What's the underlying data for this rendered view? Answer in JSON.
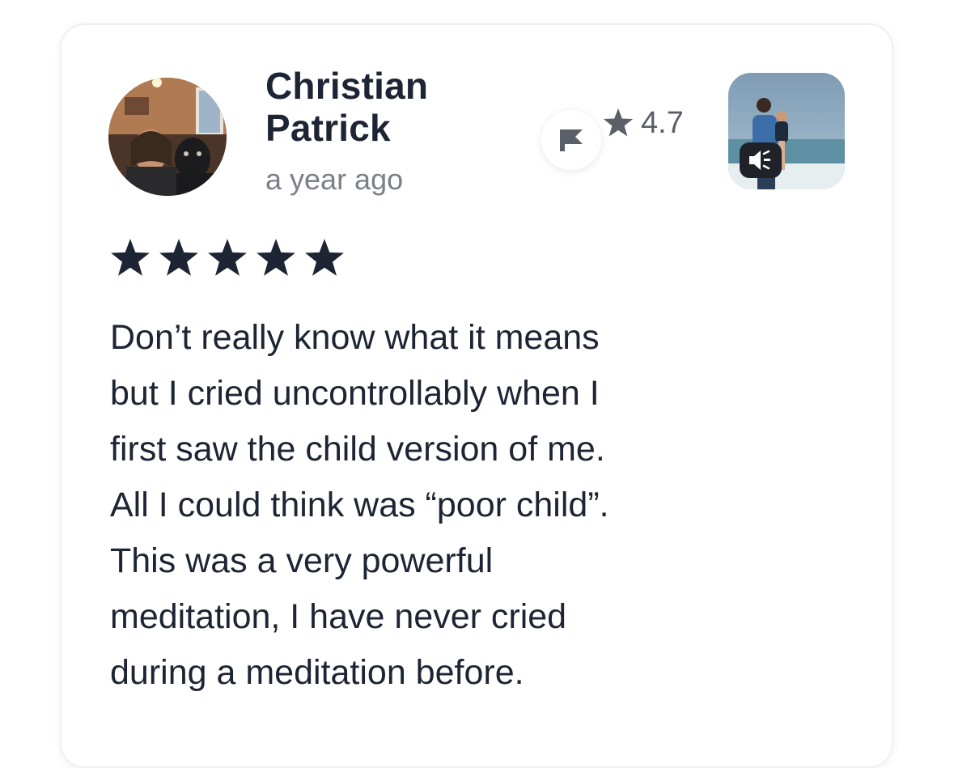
{
  "review": {
    "author_name": "Christian Patrick",
    "timestamp": "a year ago",
    "stars": 5,
    "text": "Don’t really know what it means\nbut I cried uncontrollably when I\nfirst saw the child version of me.\nAll I could think was “poor child”.\nThis was a very powerful\nmeditation, I have never cried\nduring a meditation before."
  },
  "track": {
    "rating": "4.7",
    "media_type_icon": "speaker-icon"
  },
  "icons": {
    "flag": "flag-icon",
    "rating_star": "star-icon",
    "review_star": "star-icon"
  },
  "colors": {
    "text_primary": "#1d2433",
    "text_secondary": "#7a7f88",
    "rating_text": "#5b6068",
    "star_fill": "#1d2433"
  }
}
